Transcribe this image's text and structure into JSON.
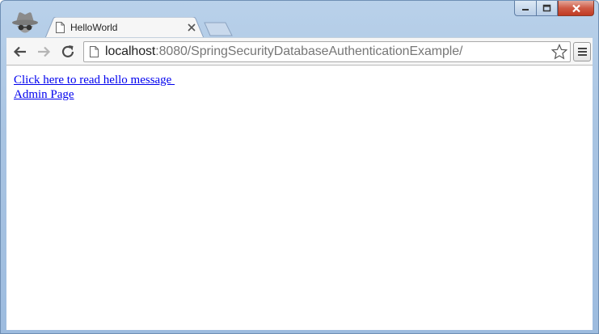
{
  "window": {
    "controls": {
      "minimize": "minimize",
      "maximize": "maximize",
      "close": "close"
    }
  },
  "tab": {
    "title": "HelloWorld",
    "icon": "page-icon",
    "close_icon": "close-icon"
  },
  "toolbar": {
    "back_icon": "back-arrow-icon",
    "forward_icon": "forward-arrow-icon",
    "reload_icon": "reload-icon",
    "url_host": "localhost",
    "url_rest": ":8080/SpringSecurityDatabaseAuthenticationExample/",
    "bookmark_icon": "star-icon",
    "menu_icon": "hamburger-menu-icon"
  },
  "page": {
    "links": [
      {
        "label": "Click here to read hello message "
      },
      {
        "label": "Admin Page"
      }
    ]
  },
  "colors": {
    "titlebar": "#b9d1ea",
    "link": "#0000ee",
    "close_button": "#c03a22"
  }
}
